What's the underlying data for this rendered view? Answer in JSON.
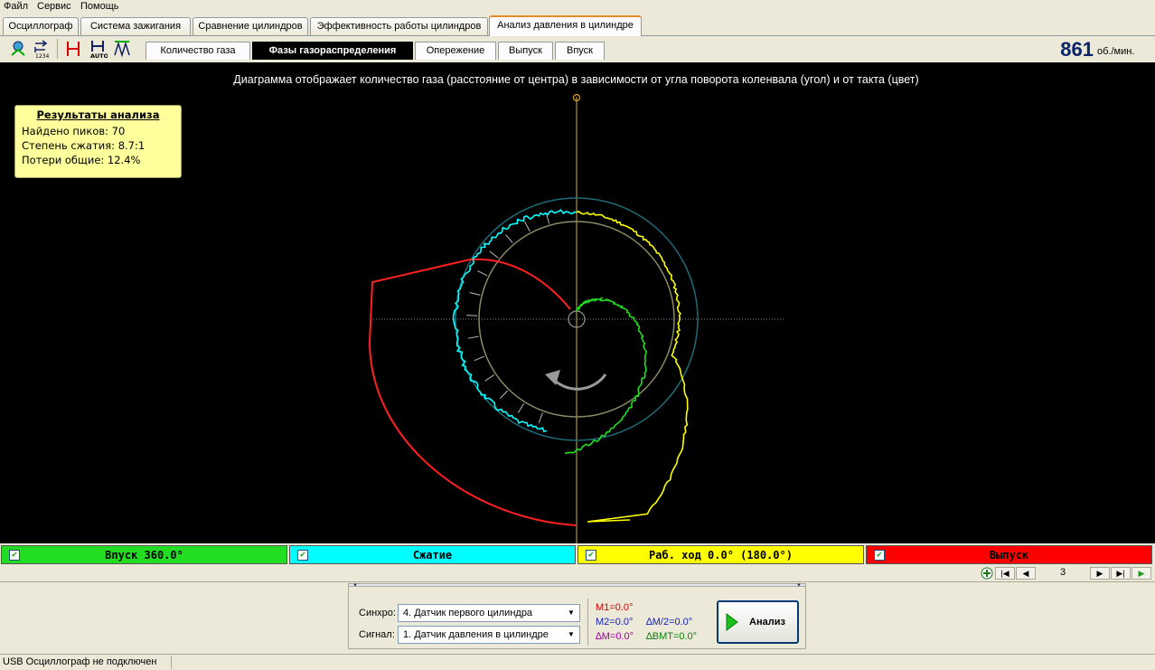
{
  "menu": [
    "Файл",
    "Сервис",
    "Помощь"
  ],
  "tabs": [
    "Осциллограф",
    "Система зажигания",
    "Сравнение цилиндров",
    "Эффективность работы цилиндров",
    "Анализ давления в цилиндре"
  ],
  "active_tab": "Анализ давления в цилиндре",
  "subtabs": [
    "Количество газа",
    "Фазы газораспределения",
    "Опережение",
    "Выпуск",
    "Впуск"
  ],
  "active_subtab": "Фазы газораспределения",
  "rpm": {
    "value": "861",
    "unit": "об./мин."
  },
  "diagram_title": "Диаграмма отображает количество газа (расстояние от центра) в зависимости от угла поворота коленвала (угол) и от такта (цвет)",
  "results": {
    "header": "Результаты анализа",
    "lines": [
      "Найдено пиков: 70",
      "Степень сжатия: 8.7:1",
      "Потери общие: 12.4%"
    ]
  },
  "phases": [
    {
      "label": "Впуск 360.0°",
      "color": "#22dd22"
    },
    {
      "label": "Сжатие",
      "color": "#00ffff"
    },
    {
      "label": "Раб. ход 0.0° (180.0°)",
      "color": "#ffff00"
    },
    {
      "label": "Выпуск",
      "color": "#ff0000"
    }
  ],
  "page_number": "3",
  "controls": {
    "sync_label": "Синхро:",
    "sync_value": "4.  Датчик первого цилиндра",
    "signal_label": "Сигнал:",
    "signal_value": "1.  Датчик давления в цилиндре",
    "m1": "M1=0.0°",
    "m2": "M2=0.0°",
    "dm2": "∆M/2=0.0°",
    "dm": "∆M=0.0°",
    "dbmt": "∆ВМТ=0.0°",
    "analyze_label": "Анализ"
  },
  "status": "USB Осциллограф не подключен",
  "colors": {
    "intake": "#22dd22",
    "compression": "#00ffff",
    "power": "#ffff00",
    "exhaust": "#ff0000",
    "rpm": "#0a246a"
  }
}
